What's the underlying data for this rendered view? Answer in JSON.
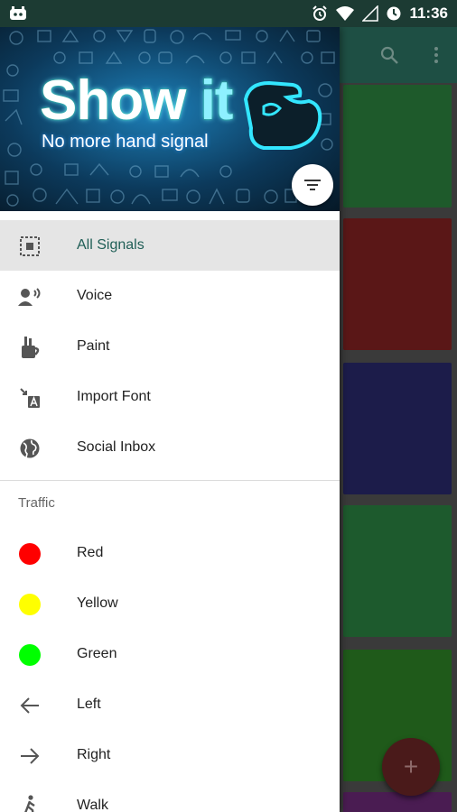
{
  "status_bar": {
    "time": "11:36",
    "icons": [
      "android-debug-icon",
      "alarm-icon",
      "wifi-icon",
      "signal-icon",
      "sync-icon"
    ]
  },
  "toolbar": {
    "icons": [
      "search-icon",
      "more-vert-icon"
    ]
  },
  "banner": {
    "title_main": "Show ",
    "title_accent": "it",
    "subtitle": "No more hand signal"
  },
  "menu": {
    "items": [
      {
        "label": "All Signals",
        "icon": "all-signals-icon"
      },
      {
        "label": "Voice",
        "icon": "voice-icon"
      },
      {
        "label": "Paint",
        "icon": "paint-icon"
      },
      {
        "label": "Import Font",
        "icon": "import-font-icon"
      },
      {
        "label": "Social Inbox",
        "icon": "globe-icon"
      }
    ],
    "section_title": "Traffic",
    "traffic": [
      {
        "label": "Red",
        "color": "#ff0000"
      },
      {
        "label": "Yellow",
        "color": "#ffff00"
      },
      {
        "label": "Green",
        "color": "#00ff00"
      },
      {
        "label": "Left",
        "icon": "arrow-left-icon"
      },
      {
        "label": "Right",
        "icon": "arrow-right-icon"
      },
      {
        "label": "Walk",
        "icon": "walk-icon"
      }
    ]
  },
  "cards": [
    {
      "color": "#1e5a2b"
    },
    {
      "color": "#5a1717"
    },
    {
      "color": "#1c1c4a"
    },
    {
      "color": "#1d5a2d"
    },
    {
      "color": "#1f5a1a"
    },
    {
      "color": "#4a1c52"
    }
  ],
  "fab": {
    "label": "+",
    "icon": "add-icon"
  },
  "colors": {
    "status_bar": "#1c3b33",
    "toolbar": "#1e4f44",
    "selected_text": "#1f5e56"
  }
}
